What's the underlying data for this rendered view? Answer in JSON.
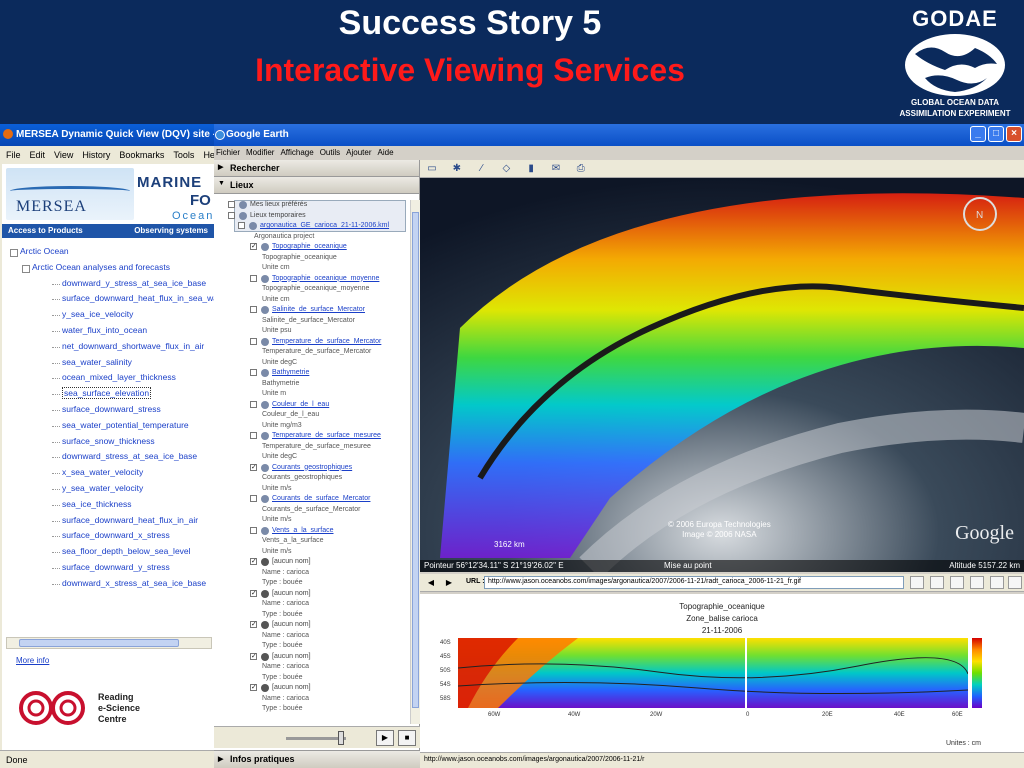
{
  "slide": {
    "title": "Success Story 5",
    "subtitle": "Interactive Viewing Services",
    "logo_name": "GODAE",
    "logo_sub1": "GLOBAL OCEAN DATA",
    "logo_sub2": "ASSIMILATION EXPERIMENT",
    "title_color": "#ffffff",
    "subtitle_color": "#ff1a1a"
  },
  "firefox": {
    "title": "MERSEA Dynamic Quick View (DQV) site - Mo",
    "menu": [
      "File",
      "Edit",
      "View",
      "History",
      "Bookmarks",
      "Tools",
      "Help"
    ],
    "banner": {
      "logo": "MERSEA",
      "marine": "MARINE",
      "fo": "FO",
      "ocean": "Ocean"
    },
    "nav": {
      "left": "Access to Products",
      "right": "Observing systems"
    },
    "tree": [
      {
        "label": "Arctic Ocean",
        "level": 0
      },
      {
        "label": "Arctic Ocean analyses and forecasts",
        "level": 1
      },
      {
        "label": "downward_y_stress_at_sea_ice_base",
        "level": 2
      },
      {
        "label": "surface_downward_heat_flux_in_sea_wat",
        "level": 2
      },
      {
        "label": "y_sea_ice_velocity",
        "level": 2
      },
      {
        "label": "water_flux_into_ocean",
        "level": 2
      },
      {
        "label": "net_downward_shortwave_flux_in_air",
        "level": 2
      },
      {
        "label": "sea_water_salinity",
        "level": 2
      },
      {
        "label": "ocean_mixed_layer_thickness",
        "level": 2
      },
      {
        "label": "sea_surface_elevation",
        "level": 2,
        "selected": true
      },
      {
        "label": "surface_downward_stress",
        "level": 2
      },
      {
        "label": "sea_water_potential_temperature",
        "level": 2
      },
      {
        "label": "surface_snow_thickness",
        "level": 2
      },
      {
        "label": "downward_stress_at_sea_ice_base",
        "level": 2
      },
      {
        "label": "x_sea_water_velocity",
        "level": 2
      },
      {
        "label": "y_sea_water_velocity",
        "level": 2
      },
      {
        "label": "sea_ice_thickness",
        "level": 2
      },
      {
        "label": "surface_downward_heat_flux_in_air",
        "level": 2
      },
      {
        "label": "surface_downward_x_stress",
        "level": 2
      },
      {
        "label": "sea_floor_depth_below_sea_level",
        "level": 2
      },
      {
        "label": "surface_downward_y_stress",
        "level": 2
      },
      {
        "label": "downward_x_stress_at_sea_ice_base",
        "level": 2
      }
    ],
    "more_info": "More info",
    "reading": [
      "Reading",
      "e-Science",
      "Centre"
    ],
    "status": "Done"
  },
  "ge": {
    "title": "Google Earth",
    "menu": [
      "Fichier",
      "Modifier",
      "Affichage",
      "Outils",
      "Ajouter",
      "Aide"
    ],
    "search_panel": "Rechercher",
    "places_panel": "Lieux",
    "footer_panel": "Infos pratiques",
    "places": [
      {
        "t": "Mes lieux préférés",
        "i": 14,
        "type": "folder"
      },
      {
        "t": "Lieux temporaires",
        "i": 14,
        "type": "folder"
      },
      {
        "t": "argonautica_GE_carioca_21-11-2006.kml",
        "i": 24,
        "type": "layer"
      },
      {
        "t": "Argonautica project",
        "i": 40,
        "type": "sub"
      },
      {
        "t": "Topographie_oceanique",
        "i": 36,
        "type": "layer",
        "check": true
      },
      {
        "t": "Topographie_oceanique",
        "i": 48,
        "type": "sub"
      },
      {
        "t": "Unite cm",
        "i": 48,
        "type": "sub"
      },
      {
        "t": "Topographie_oceanique_moyenne",
        "i": 36,
        "type": "layer"
      },
      {
        "t": "Topographie_oceanique_moyenne",
        "i": 48,
        "type": "sub"
      },
      {
        "t": "Unite cm",
        "i": 48,
        "type": "sub"
      },
      {
        "t": "Salinite_de_surface_Mercator",
        "i": 36,
        "type": "layer"
      },
      {
        "t": "Salinite_de_surface_Mercator",
        "i": 48,
        "type": "sub"
      },
      {
        "t": "Unite psu",
        "i": 48,
        "type": "sub"
      },
      {
        "t": "Temperature_de_surface_Mercator",
        "i": 36,
        "type": "layer"
      },
      {
        "t": "Temperature_de_surface_Mercator",
        "i": 48,
        "type": "sub"
      },
      {
        "t": "Unite degC",
        "i": 48,
        "type": "sub"
      },
      {
        "t": "Bathymetrie",
        "i": 36,
        "type": "layer"
      },
      {
        "t": "Bathymetrie",
        "i": 48,
        "type": "sub"
      },
      {
        "t": "Unite m",
        "i": 48,
        "type": "sub"
      },
      {
        "t": "Couleur_de_l_eau",
        "i": 36,
        "type": "layer"
      },
      {
        "t": "Couleur_de_l_eau",
        "i": 48,
        "type": "sub"
      },
      {
        "t": "Unite mg/m3",
        "i": 48,
        "type": "sub"
      },
      {
        "t": "Temperature_de_surface_mesuree",
        "i": 36,
        "type": "layer"
      },
      {
        "t": "Temperature_de_surface_mesuree",
        "i": 48,
        "type": "sub"
      },
      {
        "t": "Unite degC",
        "i": 48,
        "type": "sub"
      },
      {
        "t": "Courants_geostrophiques",
        "i": 36,
        "type": "layer",
        "check": true
      },
      {
        "t": "Courants_geostrophiques",
        "i": 48,
        "type": "sub"
      },
      {
        "t": "Unite m/s",
        "i": 48,
        "type": "sub"
      },
      {
        "t": "Courants_de_surface_Mercator",
        "i": 36,
        "type": "layer"
      },
      {
        "t": "Courants_de_surface_Mercator",
        "i": 48,
        "type": "sub"
      },
      {
        "t": "Unite m/s",
        "i": 48,
        "type": "sub"
      },
      {
        "t": "Vents_a_la_surface",
        "i": 36,
        "type": "layer"
      },
      {
        "t": "Vents_a_la_surface",
        "i": 48,
        "type": "sub"
      },
      {
        "t": "Unite m/s",
        "i": 48,
        "type": "sub"
      },
      {
        "t": "[aucun nom]",
        "i": 36,
        "type": "point",
        "check": true
      },
      {
        "t": "Name : carioca",
        "i": 48,
        "type": "sub"
      },
      {
        "t": "Type : bouée",
        "i": 48,
        "type": "sub"
      },
      {
        "t": "[aucun nom]",
        "i": 36,
        "type": "point",
        "check": true
      },
      {
        "t": "Name : carioca",
        "i": 48,
        "type": "sub"
      },
      {
        "t": "Type : bouée",
        "i": 48,
        "type": "sub"
      },
      {
        "t": "[aucun nom]",
        "i": 36,
        "type": "point",
        "check": true
      },
      {
        "t": "Name : carioca",
        "i": 48,
        "type": "sub"
      },
      {
        "t": "Type : bouée",
        "i": 48,
        "type": "sub"
      },
      {
        "t": "[aucun nom]",
        "i": 36,
        "type": "point",
        "check": true
      },
      {
        "t": "Name : carioca",
        "i": 48,
        "type": "sub"
      },
      {
        "t": "Type : bouée",
        "i": 48,
        "type": "sub"
      },
      {
        "t": "[aucun nom]",
        "i": 36,
        "type": "point",
        "check": true
      },
      {
        "t": "Name : carioca",
        "i": 48,
        "type": "sub"
      },
      {
        "t": "Type : bouée",
        "i": 48,
        "type": "sub"
      }
    ],
    "map": {
      "copyright1": "© 2006 Europa Technologies",
      "copyright2": "Image © 2006 NASA",
      "google": "Google",
      "scale": "3162 km",
      "pointer": "Pointeur 56°12'34.11\" S  21°19'26.02\" E",
      "mise": "Mise au point",
      "altitude": "Altitude 5157.22 km"
    },
    "browser": {
      "url_label": "URL :",
      "url": "http://www.jason.oceanobs.com/images/argonautica/2007/2006-11-21/radt_carioca_2006-11-21_fr.gif"
    },
    "plot": {
      "title1": "Topographie_oceanique",
      "title2": "Zone_balise carioca",
      "title3": "21-11-2006",
      "units": "Unites : cm",
      "lat_ticks": [
        "40S",
        "45S",
        "50S",
        "54S",
        "58S"
      ],
      "lon_ticks": [
        "60W",
        "40W",
        "20W",
        "0",
        "20E",
        "40E",
        "60E"
      ]
    },
    "status": "http://www.jason.oceanobs.com/images/argonautica/2007/2006-11-21/r"
  }
}
